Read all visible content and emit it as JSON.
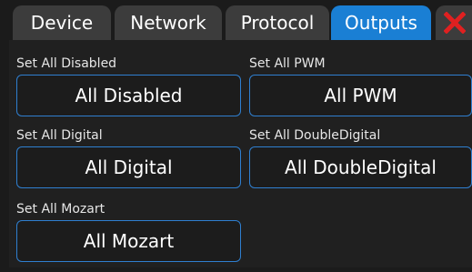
{
  "tabs": [
    {
      "label": "Device",
      "active": false
    },
    {
      "label": "Network",
      "active": false
    },
    {
      "label": "Protocol",
      "active": false
    },
    {
      "label": "Outputs",
      "active": true
    }
  ],
  "close_icon": "close-x-icon",
  "colors": {
    "active_tab": "#1a7fd4",
    "inactive_tab": "#3c3c3c",
    "button_border": "#2f7fd0",
    "close_icon": "#e02020",
    "background": "#1b1b1b"
  },
  "groups": {
    "disabled": {
      "label": "Set All Disabled",
      "button": "All Disabled"
    },
    "pwm": {
      "label": "Set All PWM",
      "button": "All PWM"
    },
    "digital": {
      "label": "Set All Digital",
      "button": "All Digital"
    },
    "double_digital": {
      "label": "Set All DoubleDigital",
      "button": "All DoubleDigital"
    },
    "mozart": {
      "label": "Set All Mozart",
      "button": "All Mozart"
    }
  }
}
